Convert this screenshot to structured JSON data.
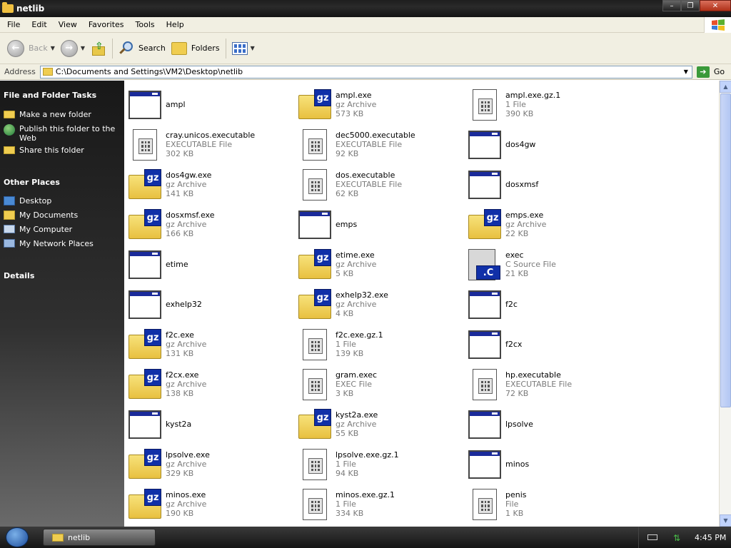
{
  "window": {
    "title": "netlib"
  },
  "menu": [
    "File",
    "Edit",
    "View",
    "Favorites",
    "Tools",
    "Help"
  ],
  "toolbar": {
    "back": "Back",
    "search": "Search",
    "folders": "Folders"
  },
  "address": {
    "label": "Address",
    "path": "C:\\Documents and Settings\\VM2\\Desktop\\netlib",
    "go": "Go"
  },
  "sidebar": {
    "tasks_title": "File and Folder Tasks",
    "tasks": [
      "Make a new folder",
      "Publish this folder to the Web",
      "Share this folder"
    ],
    "places_title": "Other Places",
    "places": [
      "Desktop",
      "My Documents",
      "My Computer",
      "My Network Places"
    ],
    "details_title": "Details"
  },
  "files": [
    {
      "name": "ampl",
      "type": "",
      "size": "",
      "icon": "window"
    },
    {
      "name": "ampl.exe",
      "type": "gz Archive",
      "size": "573 KB",
      "icon": "gz"
    },
    {
      "name": "ampl.exe.gz.1",
      "type": "1 File",
      "size": "390 KB",
      "icon": "doc"
    },
    {
      "name": "cray.unicos.executable",
      "type": "EXECUTABLE File",
      "size": "302 KB",
      "icon": "doc"
    },
    {
      "name": "dec5000.executable",
      "type": "EXECUTABLE File",
      "size": "92 KB",
      "icon": "doc"
    },
    {
      "name": "dos4gw",
      "type": "",
      "size": "",
      "icon": "window"
    },
    {
      "name": "dos4gw.exe",
      "type": "gz Archive",
      "size": "141 KB",
      "icon": "gz"
    },
    {
      "name": "dos.executable",
      "type": "EXECUTABLE File",
      "size": "62 KB",
      "icon": "doc"
    },
    {
      "name": "dosxmsf",
      "type": "",
      "size": "",
      "icon": "window"
    },
    {
      "name": "dosxmsf.exe",
      "type": "gz Archive",
      "size": "166 KB",
      "icon": "gz"
    },
    {
      "name": "emps",
      "type": "",
      "size": "",
      "icon": "window"
    },
    {
      "name": "emps.exe",
      "type": "gz Archive",
      "size": "22 KB",
      "icon": "gz"
    },
    {
      "name": "etime",
      "type": "",
      "size": "",
      "icon": "window"
    },
    {
      "name": "etime.exe",
      "type": "gz Archive",
      "size": "5 KB",
      "icon": "gz"
    },
    {
      "name": "exec",
      "type": "C Source File",
      "size": "21 KB",
      "icon": "c"
    },
    {
      "name": "exhelp32",
      "type": "",
      "size": "",
      "icon": "window"
    },
    {
      "name": "exhelp32.exe",
      "type": "gz Archive",
      "size": "4 KB",
      "icon": "gz"
    },
    {
      "name": "f2c",
      "type": "",
      "size": "",
      "icon": "window"
    },
    {
      "name": "f2c.exe",
      "type": "gz Archive",
      "size": "131 KB",
      "icon": "gz"
    },
    {
      "name": "f2c.exe.gz.1",
      "type": "1 File",
      "size": "139 KB",
      "icon": "doc"
    },
    {
      "name": "f2cx",
      "type": "",
      "size": "",
      "icon": "window"
    },
    {
      "name": "f2cx.exe",
      "type": "gz Archive",
      "size": "138 KB",
      "icon": "gz"
    },
    {
      "name": "gram.exec",
      "type": "EXEC File",
      "size": "3 KB",
      "icon": "doc"
    },
    {
      "name": "hp.executable",
      "type": "EXECUTABLE File",
      "size": "72 KB",
      "icon": "doc"
    },
    {
      "name": "kyst2a",
      "type": "",
      "size": "",
      "icon": "window"
    },
    {
      "name": "kyst2a.exe",
      "type": "gz Archive",
      "size": "55 KB",
      "icon": "gz"
    },
    {
      "name": "lpsolve",
      "type": "",
      "size": "",
      "icon": "window"
    },
    {
      "name": "lpsolve.exe",
      "type": "gz Archive",
      "size": "329 KB",
      "icon": "gz"
    },
    {
      "name": "lpsolve.exe.gz.1",
      "type": "1 File",
      "size": "94 KB",
      "icon": "doc"
    },
    {
      "name": "minos",
      "type": "",
      "size": "",
      "icon": "window"
    },
    {
      "name": "minos.exe",
      "type": "gz Archive",
      "size": "190 KB",
      "icon": "gz"
    },
    {
      "name": "minos.exe.gz.1",
      "type": "1 File",
      "size": "334 KB",
      "icon": "doc"
    },
    {
      "name": "penis",
      "type": "File",
      "size": "1 KB",
      "icon": "doc"
    }
  ],
  "taskbar": {
    "task": "netlib",
    "clock": "4:45 PM"
  }
}
